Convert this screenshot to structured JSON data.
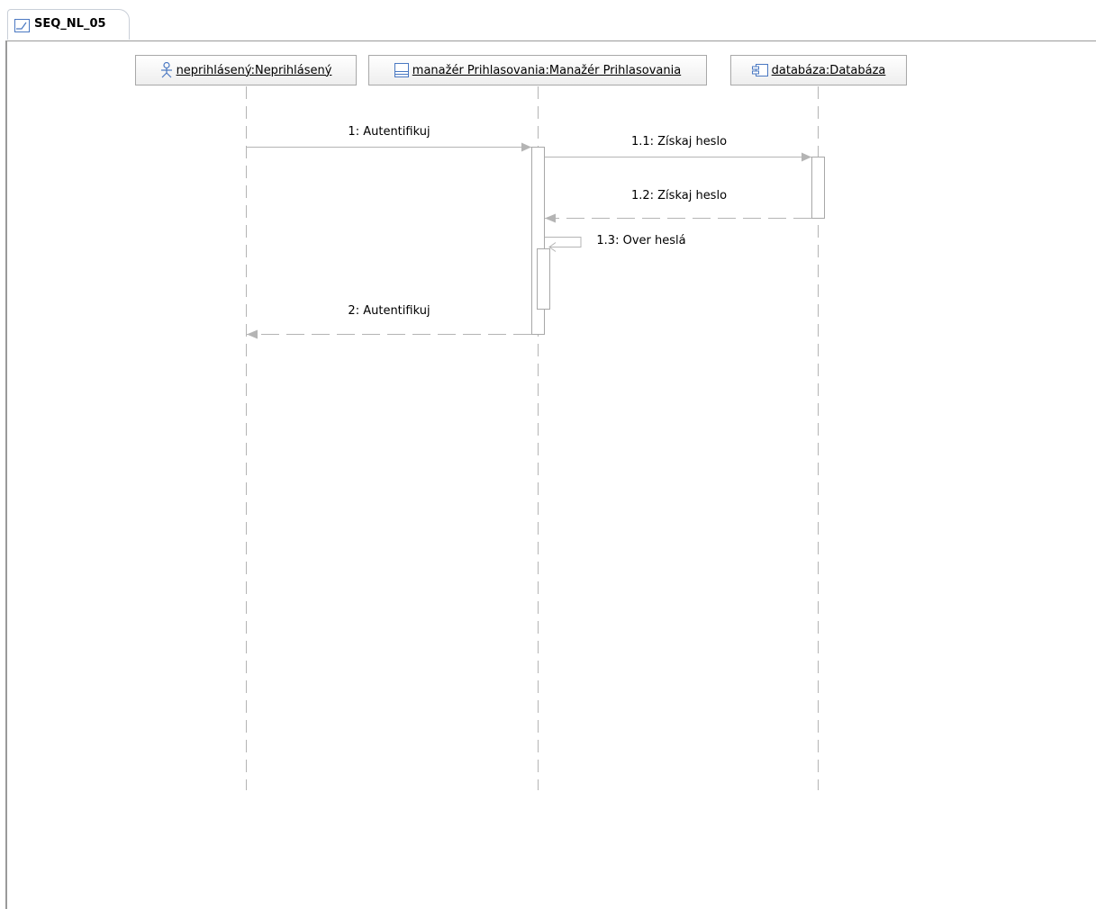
{
  "tab": {
    "title": "SEQ_NL_05",
    "icon": "sequence-diagram-icon"
  },
  "lifelines": [
    {
      "id": "ll1",
      "label": "neprihlásený:Neprihlásený",
      "icon": "actor-icon"
    },
    {
      "id": "ll2",
      "label": "manažér Prihlasovania:Manažér Prihlasovania",
      "icon": "class-icon"
    },
    {
      "id": "ll3",
      "label": "databáza:Databáza",
      "icon": "component-icon"
    }
  ],
  "messages": [
    {
      "label": "1: Autentifikuj",
      "from": "neprihlásený",
      "to": "manažér Prihlasovania",
      "kind": "synchronous"
    },
    {
      "label": "1.1: Získaj heslo",
      "from": "manažér Prihlasovania",
      "to": "databáza",
      "kind": "synchronous"
    },
    {
      "label": "1.2: Získaj heslo",
      "from": "databáza",
      "to": "manažér Prihlasovania",
      "kind": "reply"
    },
    {
      "label": "1.3: Over heslá",
      "from": "manažér Prihlasovania",
      "to": "manažér Prihlasovania",
      "kind": "self"
    },
    {
      "label": "2: Autentifikuj",
      "from": "manažér Prihlasovania",
      "to": "neprihlásený",
      "kind": "reply"
    }
  ],
  "colors": {
    "line": "#b4b4b4",
    "border": "#9a9a9a",
    "icon": "#4a78c2"
  }
}
